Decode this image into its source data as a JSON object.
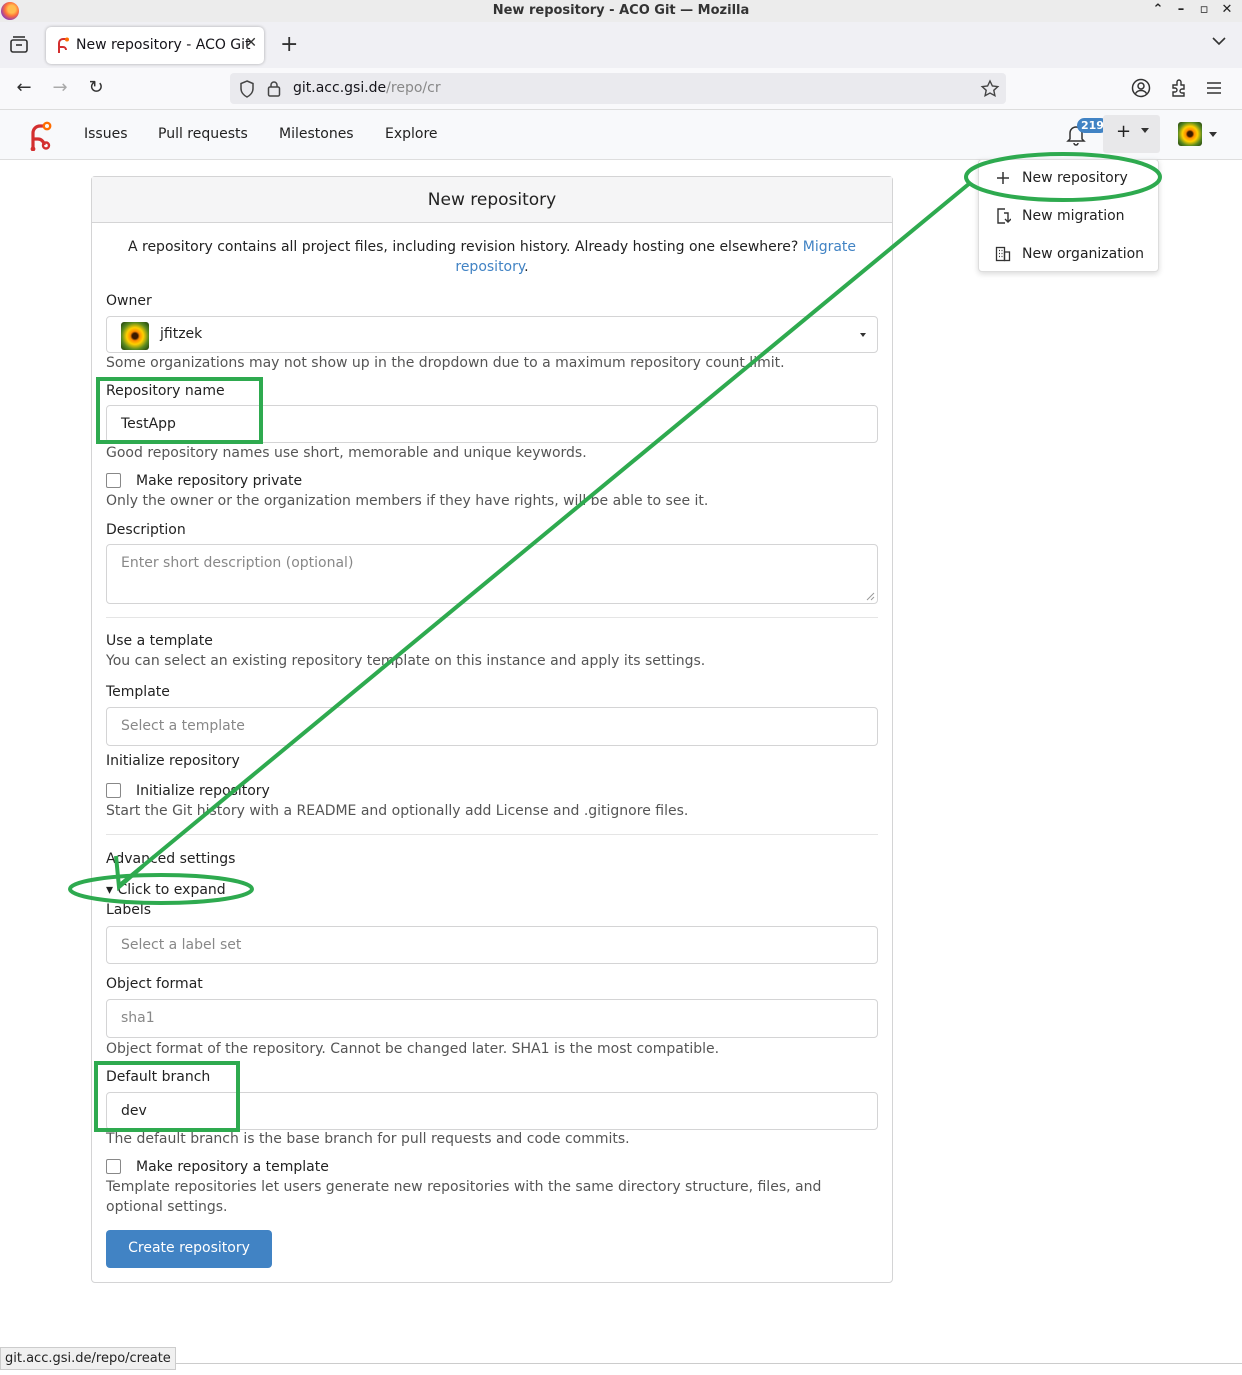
{
  "window": {
    "title": "New repository - ACO Git — Mozilla"
  },
  "browser": {
    "tab_title": "New repository - ACO Git",
    "url_host": "git.acc.gsi.de",
    "url_path": "/repo/cr",
    "status_url": "git.acc.gsi.de/repo/create"
  },
  "header": {
    "nav": [
      "Issues",
      "Pull requests",
      "Milestones",
      "Explore"
    ],
    "notification_count": "219"
  },
  "create_menu": {
    "items": [
      {
        "label": "New repository",
        "icon": "plus-icon"
      },
      {
        "label": "New migration",
        "icon": "migration-icon"
      },
      {
        "label": "New organization",
        "icon": "organization-icon"
      }
    ]
  },
  "form": {
    "title": "New repository",
    "intro_text": "A repository contains all project files, including revision history. Already hosting one elsewhere?",
    "intro_link_1": "Migrate",
    "intro_link_2": "repository",
    "owner_label": "Owner",
    "owner_value": "jfitzek",
    "owner_help": "Some organizations may not show up in the dropdown due to a maximum repository count limit.",
    "name_label": "Repository name",
    "name_value": "TestApp",
    "name_help": "Good repository names use short, memorable and unique keywords.",
    "private_label": "Make repository private",
    "private_help": "Only the owner or the organization members if they have rights, will be able to see it.",
    "description_label": "Description",
    "description_placeholder": "Enter short description (optional)",
    "template_section_title": "Use a template",
    "template_section_help": "You can select an existing repository template on this instance and apply its settings.",
    "template_label": "Template",
    "template_placeholder": "Select a template",
    "init_section_title": "Initialize repository",
    "init_label": "Initialize repository",
    "init_help": "Start the Git history with a README and optionally add License and .gitignore files.",
    "advanced_title": "Advanced settings",
    "expand_label": "▾ Click to expand",
    "labels_label": "Labels",
    "labels_placeholder": "Select a label set",
    "object_format_label": "Object format",
    "object_format_value": "sha1",
    "object_format_help": "Object format of the repository. Cannot be changed later. SHA1 is the most compatible.",
    "default_branch_label": "Default branch",
    "default_branch_value": "dev",
    "default_branch_help": "The default branch is the base branch for pull requests and code commits.",
    "template_repo_label": "Make repository a template",
    "template_repo_help_1": "Template repositories let users generate new repositories with the same directory structure, files, and",
    "template_repo_help_2": "optional settings.",
    "submit_label": "Create repository"
  },
  "colors": {
    "primary": "#4183c4",
    "annotation": "#2eaa4f",
    "badge": "#4183c4"
  }
}
